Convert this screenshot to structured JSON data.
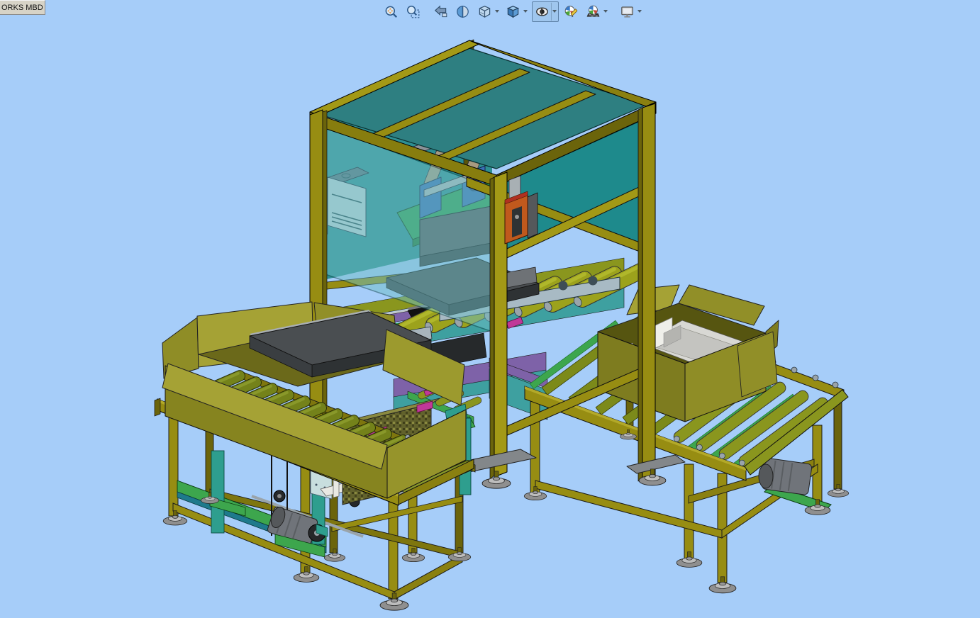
{
  "window": {
    "tab_label": "ORKS MBD"
  },
  "toolbar": {
    "buttons": [
      {
        "id": "zoom-to-fit",
        "icon": "zoom-to-fit-icon",
        "dropdown": false,
        "selected": false
      },
      {
        "id": "zoom-to-area",
        "icon": "zoom-to-area-icon",
        "dropdown": false,
        "selected": false
      },
      {
        "id": "previous-view",
        "icon": "previous-view-icon",
        "dropdown": false,
        "selected": false
      },
      {
        "id": "section-view",
        "icon": "section-view-icon",
        "dropdown": false,
        "selected": false
      },
      {
        "id": "view-orientation",
        "icon": "view-orientation-cube-icon",
        "dropdown": true,
        "selected": false
      },
      {
        "id": "display-style",
        "icon": "display-style-cube-icon",
        "dropdown": true,
        "selected": false
      },
      {
        "id": "hide-show-items",
        "icon": "eye-icon",
        "dropdown": true,
        "selected": true
      },
      {
        "id": "edit-appearance",
        "icon": "appearance-ball-pencil-icon",
        "dropdown": false,
        "selected": false
      },
      {
        "id": "apply-scene",
        "icon": "scene-ball-icon",
        "dropdown": true,
        "selected": false
      },
      {
        "id": "view-settings",
        "icon": "monitor-icon",
        "dropdown": true,
        "selected": false
      }
    ]
  },
  "viewport": {
    "background_color": "#A6CDF9",
    "model": {
      "name": "packing-cell-assembly",
      "components": [
        "gantry-enclosure",
        "roof-glass-panels",
        "side-glass-panels",
        "center-roller-conveyor",
        "left-roller-conveyor-table",
        "right-belt-conveyor-table",
        "cardboard-box-left",
        "cardboard-box-right",
        "foam-insert",
        "flat-panel-product",
        "control-box",
        "orange-actuator",
        "pick-mechanism",
        "drive-motor-left",
        "drive-motor-right",
        "wire-basket",
        "caster-cart",
        "leveling-feet"
      ],
      "colors": {
        "frame_olive": "#978D12",
        "frame_light": "#B3A929",
        "frame_dark": "#6B640B",
        "glass_teal": "#1E8A8C",
        "roof_glass": "#2E7F81",
        "front_glass": "#6FBEC6",
        "cardboard": "#918F28",
        "cardboard_light": "#A5A235",
        "foam_grey": "#DCDCD8",
        "roller_olive": "#74821A",
        "accent_green": "#3DA64D",
        "accent_teal": "#2E9E8E",
        "accent_purple": "#7E62A8",
        "accent_magenta": "#C03898",
        "accent_orange": "#C0591D",
        "metal_grey": "#83878A",
        "panel_dark": "#4A4E51"
      }
    }
  }
}
